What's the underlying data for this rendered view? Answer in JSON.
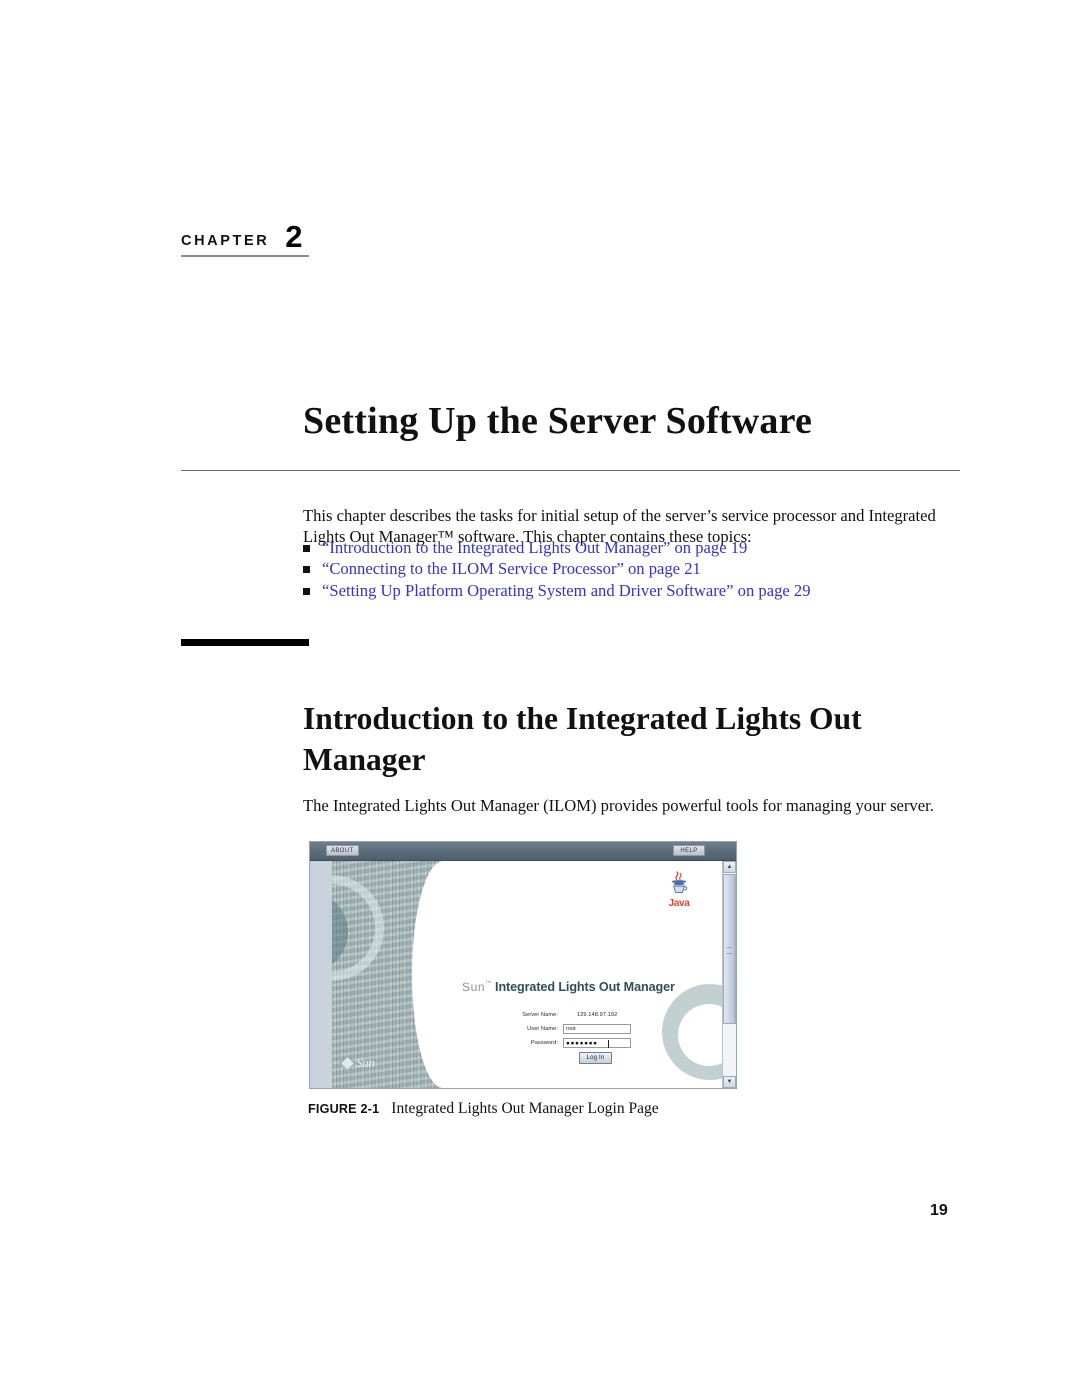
{
  "document": {
    "chapter_word": "CHAPTER",
    "chapter_number": "2",
    "chapter_title": "Setting Up the Server Software",
    "intro_paragraph": "This chapter describes the tasks for initial setup of the server’s service processor and Integrated Lights Out Manager™ software. This chapter contains these topics:",
    "page_number": "19"
  },
  "topics": [
    {
      "link": "“Introduction to the Integrated Lights Out Manager” on page",
      "page": "19"
    },
    {
      "link": "“Connecting to the ILOM Service Processor” on page",
      "page": "21"
    },
    {
      "link": "“Setting Up Platform Operating System and Driver Software” on page",
      "page": "29"
    }
  ],
  "section": {
    "title": "Introduction to the Integrated Lights Out Manager",
    "paragraph": "The Integrated Lights Out Manager (ILOM) provides powerful tools for managing your server."
  },
  "figure": {
    "label": "FIGURE 2-1",
    "caption": "Integrated Lights Out Manager Login Page"
  },
  "ilom": {
    "toolbar": {
      "about_label": "ABOUT",
      "help_label": "HELP"
    },
    "brand": {
      "vendor": "Sun",
      "trademark": "™",
      "product": "Integrated Lights Out Manager",
      "sun_logo_word": "Sun",
      "java_logo_word": "Java"
    },
    "login": {
      "server_name_label": "Server Name:",
      "server_name_value": "129.148.97.192",
      "user_name_label": "User Name:",
      "user_name_value": "root",
      "password_label": "Password:",
      "password_value": "●●●●●●●",
      "login_button": "Log In"
    },
    "scrollbar": {
      "up_arrow": "▲",
      "down_arrow": "▼"
    }
  },
  "colors": {
    "link": "#3333cc",
    "toolbar": "#5d6e7c",
    "pattern": "#9fb0b2",
    "product_text": "#2f4f58",
    "java_red": "#e0452f"
  }
}
